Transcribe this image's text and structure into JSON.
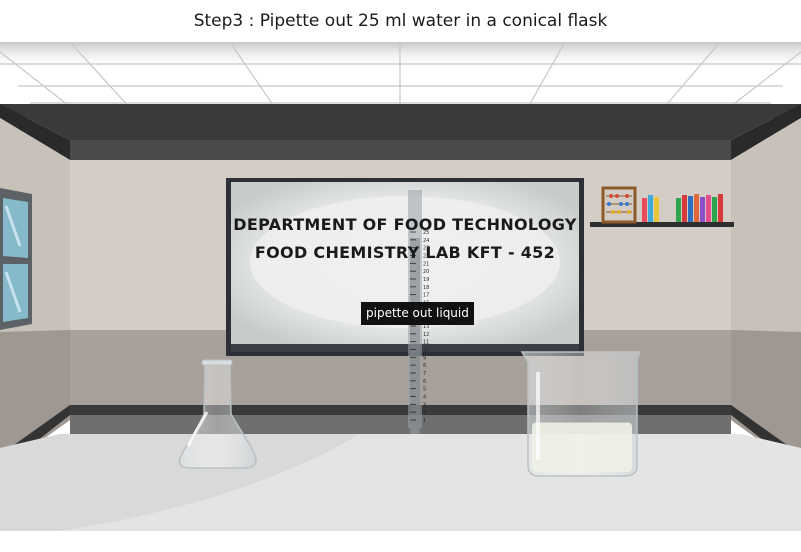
{
  "header": {
    "step_title": "Step3 : Pipette out 25 ml water in a conical flask"
  },
  "board": {
    "line1": "DEPARTMENT OF FOOD TECHNOLOGY",
    "line2": "FOOD CHEMISTRY LAB KFT - 452"
  },
  "action_button": {
    "label": "pipette out liquid"
  },
  "pipette": {
    "scale_labels": [
      "25",
      "24",
      "23",
      "22",
      "21",
      "20",
      "19",
      "18",
      "17",
      "16",
      "15",
      "14",
      "13",
      "12",
      "11",
      "10",
      "9",
      "8",
      "7",
      "6",
      "5",
      "4",
      "3",
      "2",
      "1"
    ]
  },
  "beaker": {
    "fill_fraction": 0.45
  },
  "colors": {
    "wall": "#cfc9c1",
    "lower_wall": "#a59d97",
    "ceiling": "#ffffff",
    "ceiling_trim": "#3a3a3a",
    "table": "#e8e8e8",
    "board_frame": "#2c2f36",
    "board_screen": "#dadcdc"
  }
}
